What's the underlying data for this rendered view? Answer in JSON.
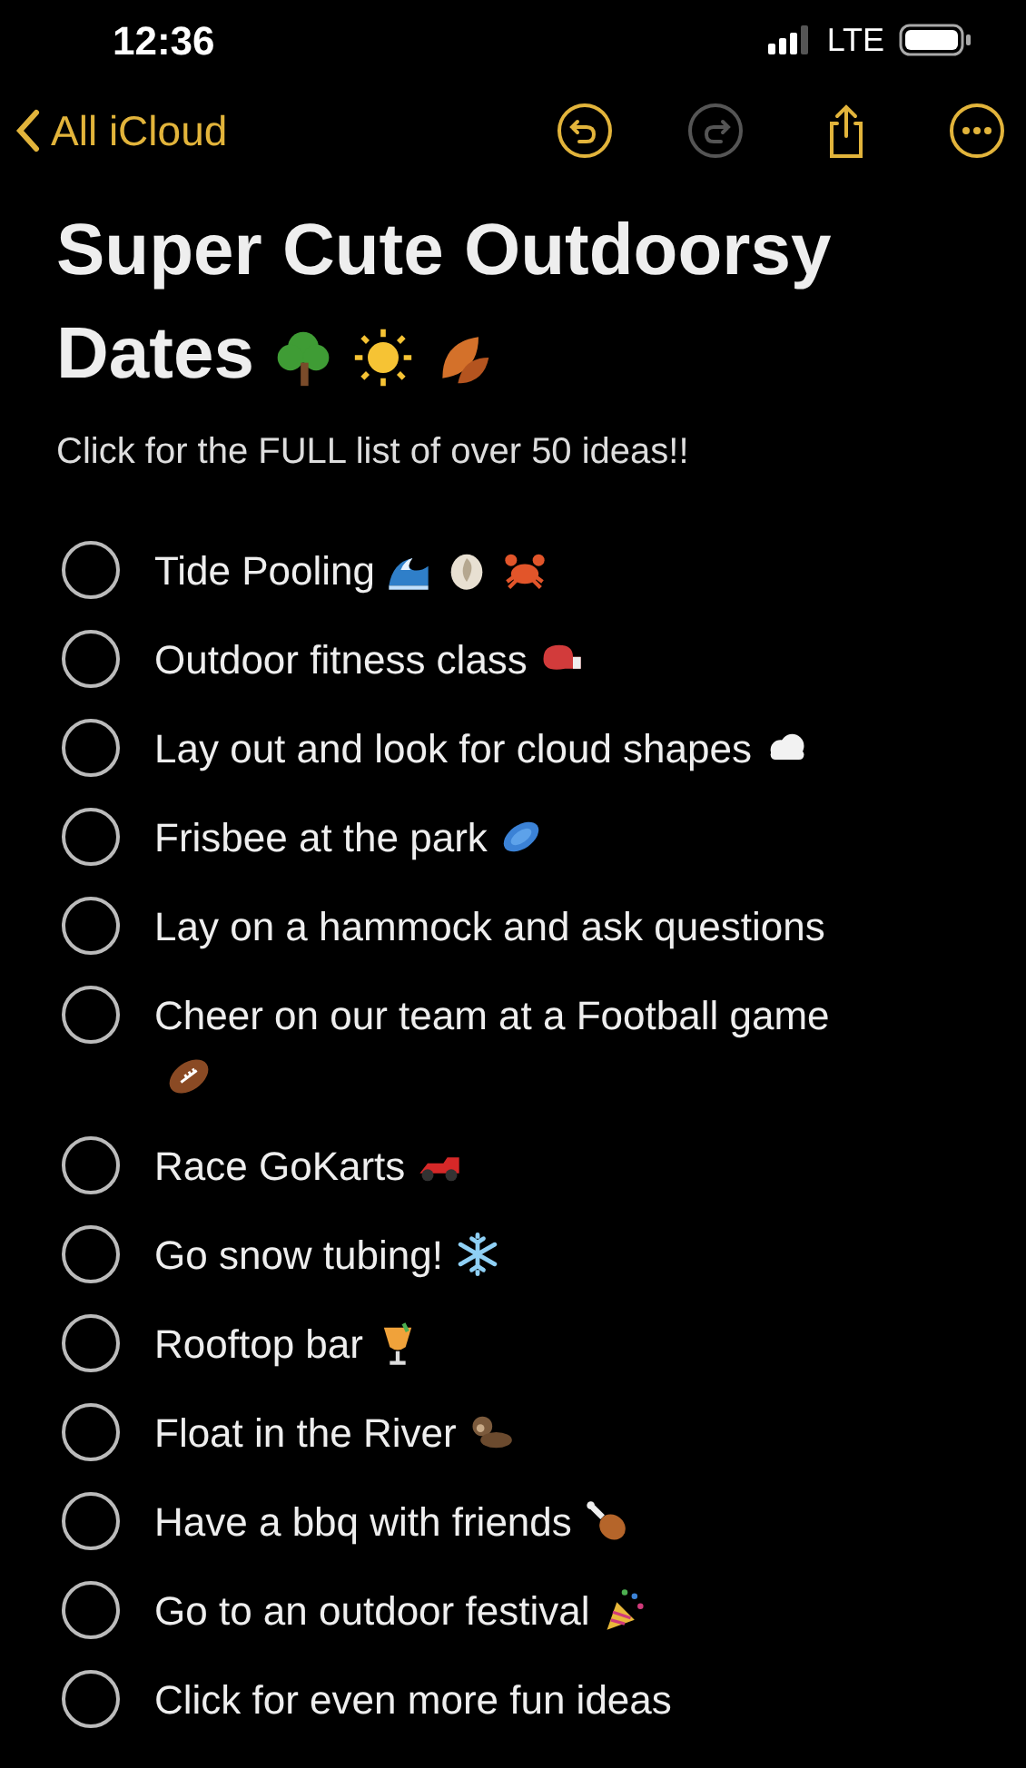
{
  "status_bar": {
    "time": "12:36",
    "network": "LTE"
  },
  "toolbar": {
    "back": {
      "label": "All iCloud"
    },
    "buttons": [
      {
        "kind": "undo",
        "disabled": false
      },
      {
        "kind": "redo",
        "disabled": true
      },
      {
        "kind": "share",
        "disabled": false
      },
      {
        "kind": "more",
        "disabled": false
      }
    ]
  },
  "note": {
    "title": "Super Cute Outdoorsy Dates",
    "title_icons": [
      {
        "kind": "tree"
      },
      {
        "kind": "sun"
      },
      {
        "kind": "leaves"
      }
    ],
    "subtitle": "Click for the FULL list of over 50 ideas!!",
    "items": [
      {
        "text": "Tide Pooling",
        "checked": false,
        "icons": [
          {
            "kind": "wave"
          },
          {
            "kind": "shell"
          },
          {
            "kind": "crab"
          }
        ]
      },
      {
        "text": "Outdoor fitness class",
        "checked": false,
        "icons": [
          {
            "kind": "glove"
          }
        ]
      },
      {
        "text": "Lay out and look for cloud shapes",
        "checked": false,
        "icons": [
          {
            "kind": "cloud"
          }
        ]
      },
      {
        "text": "Frisbee at the park",
        "checked": false,
        "icons": [
          {
            "kind": "frisbee"
          }
        ]
      },
      {
        "text": "Lay on a hammock and ask questions",
        "checked": false
      },
      {
        "text": "Cheer on our team at a Football game",
        "checked": false,
        "icons": [
          {
            "kind": "football"
          }
        ]
      },
      {
        "text": "Race GoKarts",
        "checked": false,
        "icons": [
          {
            "kind": "racecar"
          }
        ]
      },
      {
        "text": "Go snow tubing!",
        "checked": false,
        "icons": [
          {
            "kind": "snowflake"
          }
        ]
      },
      {
        "text": "Rooftop bar",
        "checked": false,
        "icons": [
          {
            "kind": "cocktail"
          }
        ]
      },
      {
        "text": "Float in the River",
        "checked": false,
        "icons": [
          {
            "kind": "otter"
          }
        ]
      },
      {
        "text": "Have a bbq with friends",
        "checked": false,
        "icons": [
          {
            "kind": "drumstick"
          }
        ]
      },
      {
        "text": "Go to an outdoor festival",
        "checked": false,
        "icons": [
          {
            "kind": "party-popper"
          }
        ]
      },
      {
        "text": "Click for even more fun ideas",
        "checked": false
      }
    ]
  }
}
